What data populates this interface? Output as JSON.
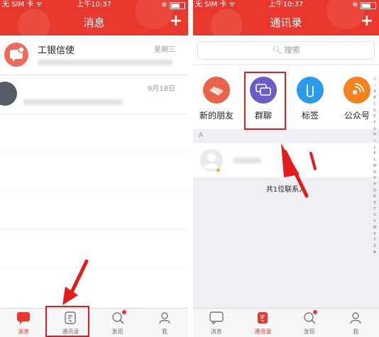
{
  "status_bar": {
    "carrier": "无 SIM 卡 ᯤ",
    "time": "上午10:37",
    "lock": "⊕"
  },
  "left": {
    "title": "消息",
    "messages": [
      {
        "name": "工银信使",
        "time": "星期三"
      },
      {
        "name": "",
        "time": "9月18日"
      }
    ]
  },
  "right": {
    "title": "通讯录",
    "search_placeholder": "搜索",
    "functions": [
      {
        "label": "新的朋友"
      },
      {
        "label": "群聊"
      },
      {
        "label": "标签"
      },
      {
        "label": "公众号"
      }
    ],
    "section_letter": "A",
    "contact_count": "共1位联系人",
    "index_letters": [
      "↑",
      "☆",
      "A",
      "B",
      "C",
      "D",
      "E",
      "F",
      "G",
      "H",
      "I",
      "J",
      "K",
      "L",
      "M",
      "N",
      "O",
      "P",
      "Q",
      "R",
      "S",
      "T",
      "U",
      "V",
      "W",
      "X",
      "Y",
      "Z",
      "#"
    ]
  },
  "tabs": [
    {
      "label": "消息"
    },
    {
      "label": "通讯录"
    },
    {
      "label": "发现"
    },
    {
      "label": "我"
    }
  ],
  "colors": {
    "accent": "#e8382d",
    "highlight": "#e21b1b"
  }
}
